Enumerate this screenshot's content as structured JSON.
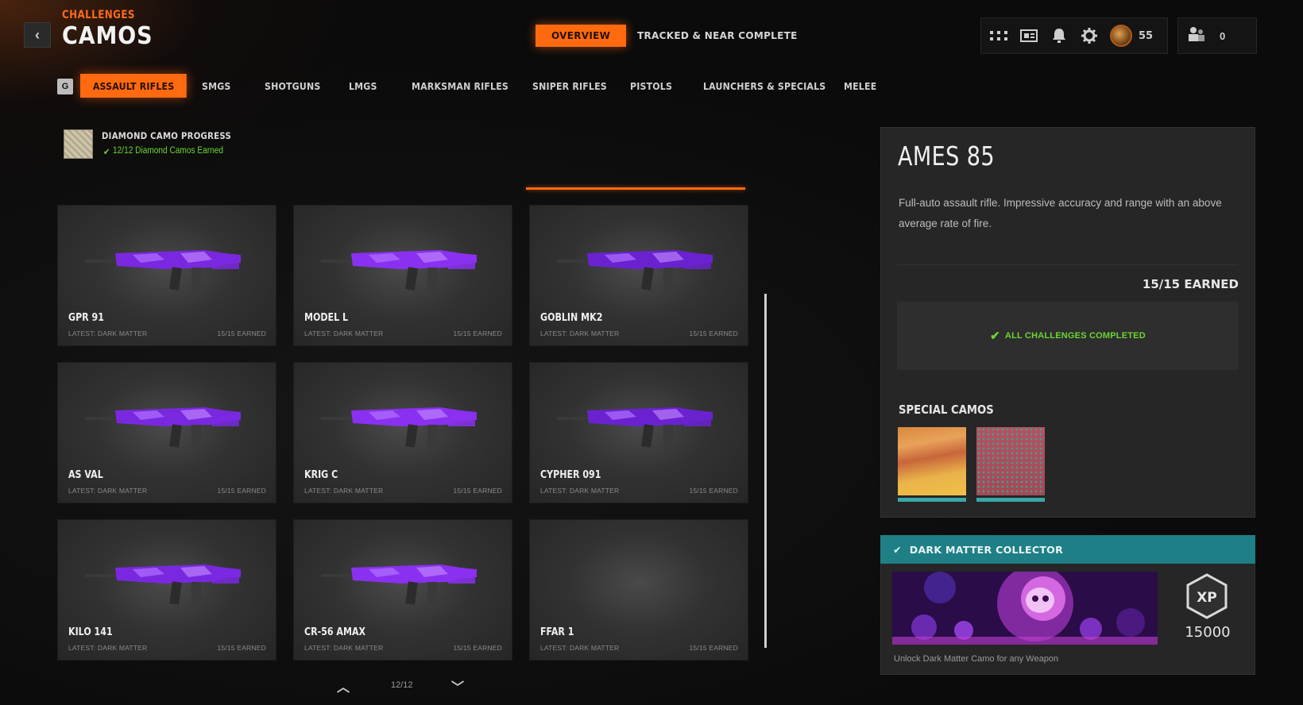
{
  "header": {
    "breadcrumb": "CHALLENGES",
    "title": "CAMOS",
    "tabs": [
      {
        "label": "OVERVIEW",
        "active": true
      },
      {
        "label": "TRACKED & NEAR COMPLETE",
        "active": false
      }
    ],
    "player_level": "55",
    "party_count": "0",
    "accent_color": "#ff6a10"
  },
  "categories": {
    "key_hint": "G",
    "items": [
      {
        "label": "ASSAULT RIFLES",
        "active": true
      },
      {
        "label": "SMGS"
      },
      {
        "label": "SHOTGUNS"
      },
      {
        "label": "LMGS"
      },
      {
        "label": "MARKSMAN RIFLES"
      },
      {
        "label": "SNIPER RIFLES"
      },
      {
        "label": "PISTOLS"
      },
      {
        "label": "LAUNCHERS & SPECIALS"
      },
      {
        "label": "MELEE"
      }
    ]
  },
  "diamond": {
    "title": "DIAMOND CAMO PROGRESS",
    "status": "12/12 Diamond Camos Earned"
  },
  "weapons": [
    {
      "name": "GPR 91",
      "latest": "LATEST: DARK MATTER",
      "earned": "15/15 EARNED",
      "has_gun": true
    },
    {
      "name": "MODEL L",
      "latest": "LATEST: DARK MATTER",
      "earned": "15/15 EARNED",
      "has_gun": true
    },
    {
      "name": "GOBLIN MK2",
      "latest": "LATEST: DARK MATTER",
      "earned": "15/15 EARNED",
      "has_gun": true
    },
    {
      "name": "AS VAL",
      "latest": "LATEST: DARK MATTER",
      "earned": "15/15 EARNED",
      "has_gun": true
    },
    {
      "name": "KRIG C",
      "latest": "LATEST: DARK MATTER",
      "earned": "15/15 EARNED",
      "has_gun": true
    },
    {
      "name": "CYPHER 091",
      "latest": "LATEST: DARK MATTER",
      "earned": "15/15 EARNED",
      "has_gun": true
    },
    {
      "name": "KILO 141",
      "latest": "LATEST: DARK MATTER",
      "earned": "15/15 EARNED",
      "has_gun": true
    },
    {
      "name": "CR-56 AMAX",
      "latest": "LATEST: DARK MATTER",
      "earned": "15/15 EARNED",
      "has_gun": true
    },
    {
      "name": "FFAR 1",
      "latest": "LATEST: DARK MATTER",
      "earned": "15/15 EARNED",
      "has_gun": false
    }
  ],
  "pager": {
    "text": "12/12"
  },
  "detail": {
    "weapon_name": "AMES 85",
    "description": "Full-auto assault rifle.  Impressive accuracy and range with an above average rate of fire.",
    "earned": "15/15 EARNED",
    "completed_text": "ALL CHALLENGES COMPLETED",
    "special_title": "SPECIAL CAMOS"
  },
  "reward": {
    "title": "DARK MATTER COLLECTOR",
    "xp": "15000",
    "description": "Unlock Dark Matter Camo for any Weapon",
    "header_color": "#1f7f86"
  }
}
